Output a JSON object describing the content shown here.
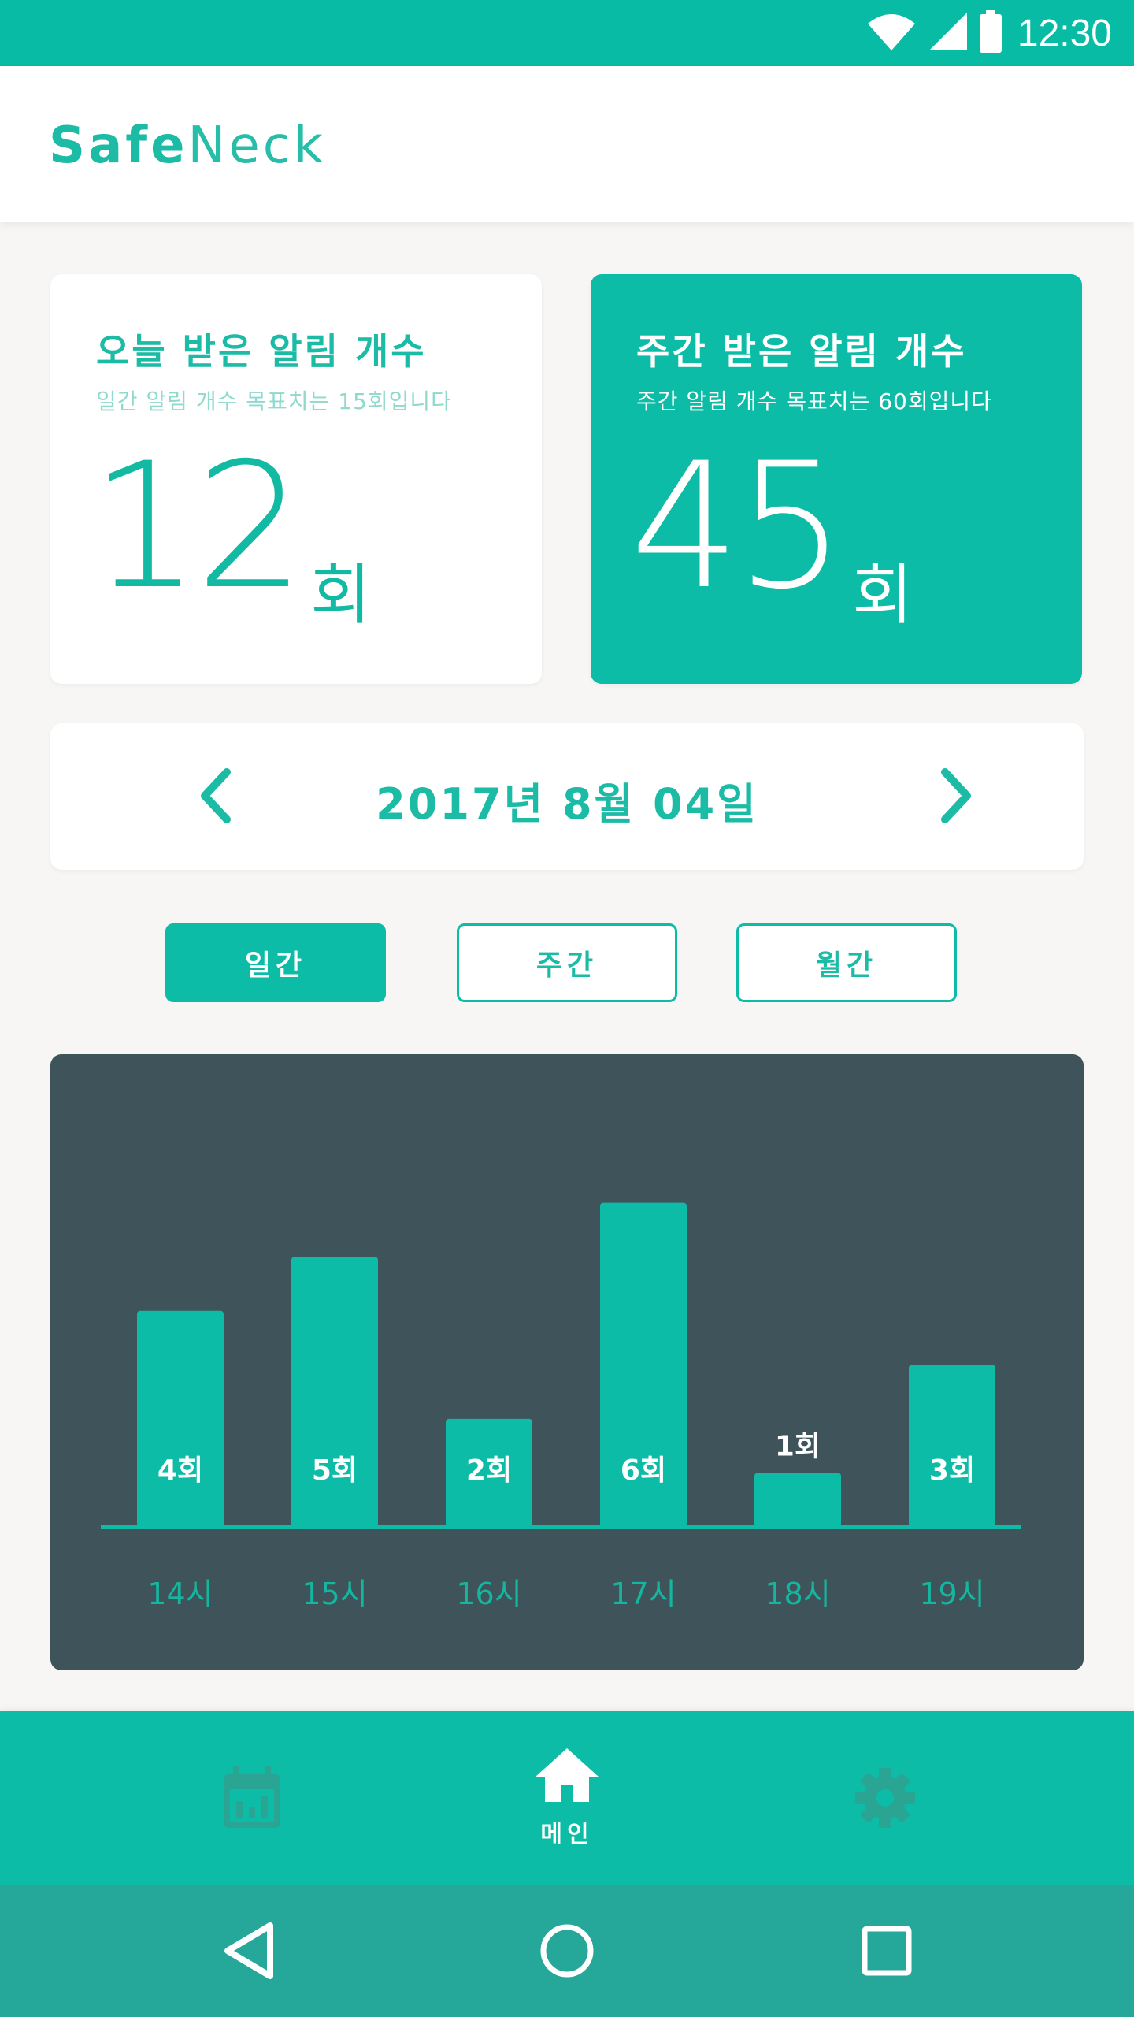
{
  "status_bar": {
    "time": "12:30"
  },
  "app": {
    "logo_bold": "Safe",
    "logo_light": "Neck"
  },
  "today_card": {
    "title": "오늘 받은 알림 개수",
    "subtitle": "일간 알림 개수 목표치는 15회입니다",
    "count": "12",
    "unit": "회"
  },
  "week_card": {
    "title": "주간 받은 알림 개수",
    "subtitle": "주간 알림 개수 목표치는 60회입니다",
    "count": "45",
    "unit": "회"
  },
  "date_selector": {
    "date": "2017년 8월 04일"
  },
  "period_tabs": {
    "daily": "일간",
    "weekly": "주간",
    "monthly": "월간",
    "selected": "daily"
  },
  "chart_data": {
    "type": "bar",
    "categories": [
      "14시",
      "15시",
      "16시",
      "17시",
      "18시",
      "19시"
    ],
    "values": [
      4,
      5,
      2,
      6,
      1,
      3
    ],
    "value_labels": [
      "4회",
      "5회",
      "2회",
      "6회",
      "1회",
      "3회"
    ],
    "ylim": [
      0,
      7
    ],
    "grid": false,
    "colors": {
      "bar": "#0dbca6",
      "background": "#3f535a",
      "axis": "#0dbca6",
      "tick": "#15b6a0"
    }
  },
  "bottom_nav": {
    "items": [
      {
        "icon": "calendar-chart-icon",
        "label": ""
      },
      {
        "icon": "home-icon",
        "label": "메인"
      },
      {
        "icon": "gear-icon",
        "label": ""
      }
    ],
    "active": "home"
  },
  "colors": {
    "accent": "#0dbca6",
    "dark_panel": "#3f535a",
    "system_nav": "#25a79a"
  }
}
